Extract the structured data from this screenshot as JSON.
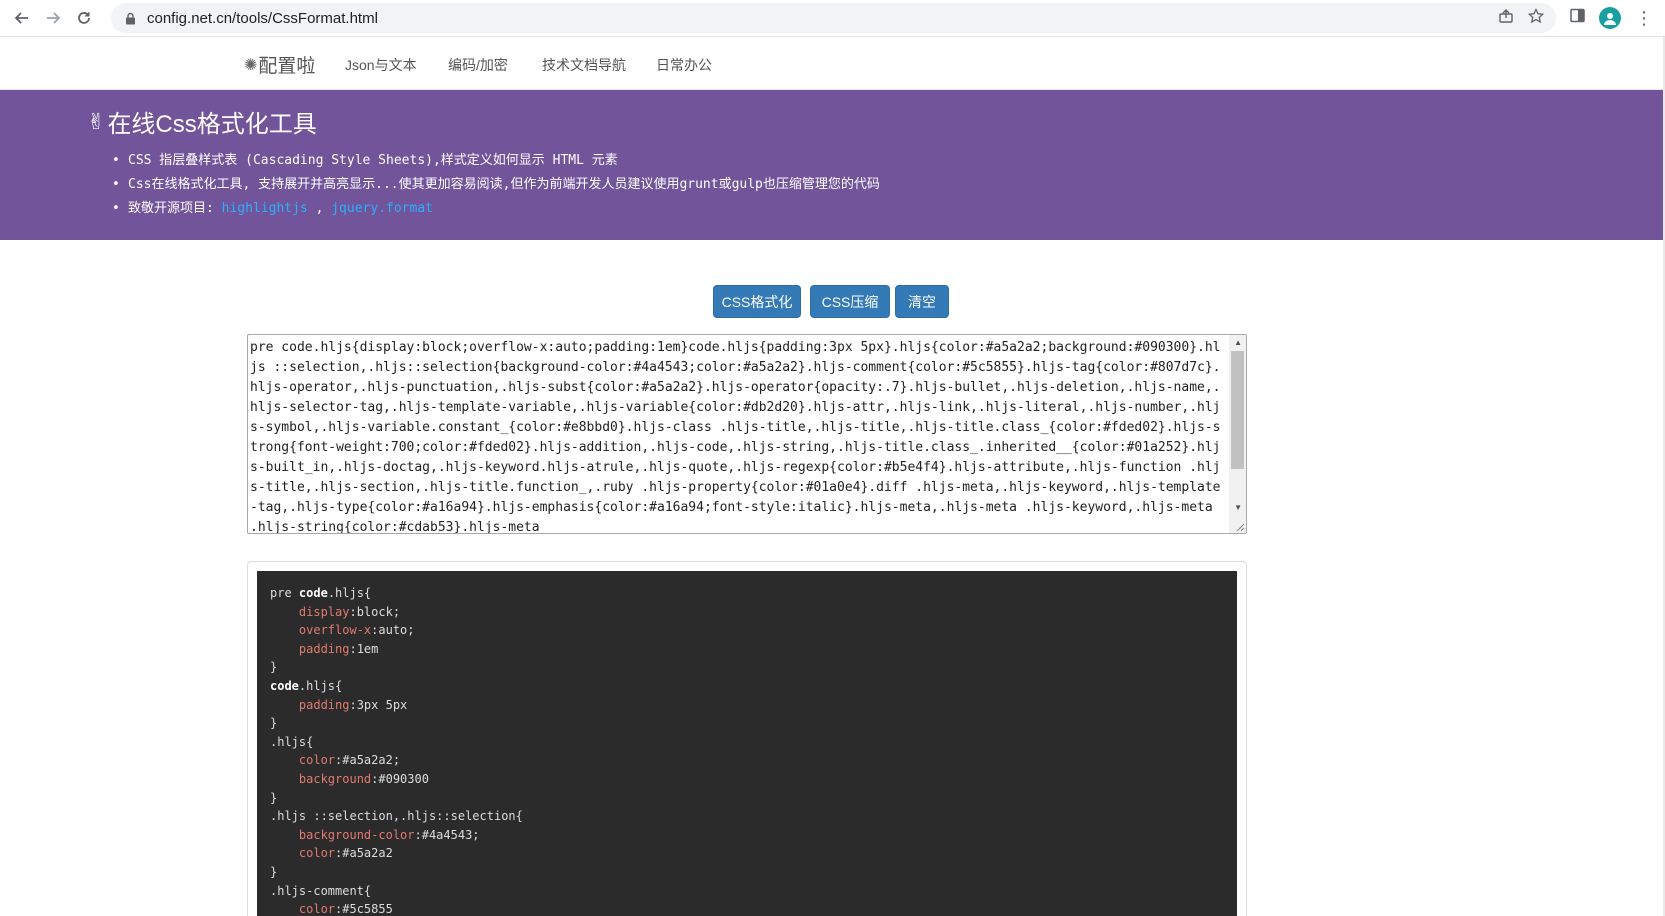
{
  "browser": {
    "url": "config.net.cn/tools/CssFormat.html"
  },
  "nav": {
    "brand": "配置啦",
    "links": [
      "Json与文本",
      "编码/加密",
      "技术文档导航",
      "日常办公"
    ]
  },
  "banner": {
    "title": "在线Css格式化工具",
    "bullet1": "CSS 指层叠样式表 (Cascading Style Sheets),样式定义如何显示 HTML 元素",
    "bullet2": "Css在线格式化工具, 支持展开并高亮显示...使其更加容易阅读,但作为前端开发人员建议使用grunt或gulp也压缩管理您的代码",
    "bullet3_prefix": "致敬开源项目: ",
    "link1": "highlightjs",
    "separator": " , ",
    "link2": "jquery.format"
  },
  "buttons": {
    "format": "CSS格式化",
    "compress": "CSS压缩",
    "clear": "清空"
  },
  "input": {
    "value": "pre code.hljs{display:block;overflow-x:auto;padding:1em}code.hljs{padding:3px 5px}.hljs{color:#a5a2a2;background:#090300}.hljs ::selection,.hljs::selection{background-color:#4a4543;color:#a5a2a2}.hljs-comment{color:#5c5855}.hljs-tag{color:#807d7c}.hljs-operator,.hljs-punctuation,.hljs-subst{color:#a5a2a2}.hljs-operator{opacity:.7}.hljs-bullet,.hljs-deletion,.hljs-name,.hljs-selector-tag,.hljs-template-variable,.hljs-variable{color:#db2d20}.hljs-attr,.hljs-link,.hljs-literal,.hljs-number,.hljs-symbol,.hljs-variable.constant_{color:#e8bbd0}.hljs-class .hljs-title,.hljs-title,.hljs-title.class_{color:#fded02}.hljs-strong{font-weight:700;color:#fded02}.hljs-addition,.hljs-code,.hljs-string,.hljs-title.class_.inherited__{color:#01a252}.hljs-built_in,.hljs-doctag,.hljs-keyword.hljs-atrule,.hljs-quote,.hljs-regexp{color:#b5e4f4}.hljs-attribute,.hljs-function .hljs-title,.hljs-section,.hljs-title.function_,.ruby .hljs-property{color:#01a0e4}.diff .hljs-meta,.hljs-keyword,.hljs-template-tag,.hljs-type{color:#a16a94}.hljs-emphasis{color:#a16a94;font-style:italic}.hljs-meta,.hljs-meta .hljs-keyword,.hljs-meta .hljs-string{color:#cdab53}.hljs-meta"
  },
  "output": {
    "lines": [
      {
        "parts": [
          {
            "t": "pre ",
            "c": ""
          },
          {
            "t": "code",
            "c": "kw"
          },
          {
            "t": ".hljs{",
            "c": ""
          }
        ]
      },
      {
        "parts": [
          {
            "t": "    ",
            "c": ""
          },
          {
            "t": "display",
            "c": "prop"
          },
          {
            "t": ":block;",
            "c": ""
          }
        ]
      },
      {
        "parts": [
          {
            "t": "    ",
            "c": ""
          },
          {
            "t": "overflow-x",
            "c": "prop"
          },
          {
            "t": ":auto;",
            "c": ""
          }
        ]
      },
      {
        "parts": [
          {
            "t": "    ",
            "c": ""
          },
          {
            "t": "padding",
            "c": "prop"
          },
          {
            "t": ":1em",
            "c": ""
          }
        ]
      },
      {
        "parts": [
          {
            "t": "}",
            "c": ""
          }
        ]
      },
      {
        "parts": [
          {
            "t": "code",
            "c": "kw"
          },
          {
            "t": ".hljs{",
            "c": ""
          }
        ]
      },
      {
        "parts": [
          {
            "t": "    ",
            "c": ""
          },
          {
            "t": "padding",
            "c": "prop"
          },
          {
            "t": ":3px 5px",
            "c": ""
          }
        ]
      },
      {
        "parts": [
          {
            "t": "}",
            "c": ""
          }
        ]
      },
      {
        "parts": [
          {
            "t": ".hljs{",
            "c": ""
          }
        ]
      },
      {
        "parts": [
          {
            "t": "    ",
            "c": ""
          },
          {
            "t": "color",
            "c": "prop"
          },
          {
            "t": ":#a5a2a2;",
            "c": ""
          }
        ]
      },
      {
        "parts": [
          {
            "t": "    ",
            "c": ""
          },
          {
            "t": "background",
            "c": "prop"
          },
          {
            "t": ":#090300",
            "c": ""
          }
        ]
      },
      {
        "parts": [
          {
            "t": "}",
            "c": ""
          }
        ]
      },
      {
        "parts": [
          {
            "t": ".hljs ::selection,.hljs::selection{",
            "c": ""
          }
        ]
      },
      {
        "parts": [
          {
            "t": "    ",
            "c": ""
          },
          {
            "t": "background-color",
            "c": "prop"
          },
          {
            "t": ":#4a4543;",
            "c": ""
          }
        ]
      },
      {
        "parts": [
          {
            "t": "    ",
            "c": ""
          },
          {
            "t": "color",
            "c": "prop"
          },
          {
            "t": ":#a5a2a2",
            "c": ""
          }
        ]
      },
      {
        "parts": [
          {
            "t": "}",
            "c": ""
          }
        ]
      },
      {
        "parts": [
          {
            "t": ".hljs-comment{",
            "c": ""
          }
        ]
      },
      {
        "parts": [
          {
            "t": "    ",
            "c": ""
          },
          {
            "t": "color",
            "c": "prop"
          },
          {
            "t": ":#5c5855",
            "c": ""
          }
        ]
      }
    ]
  },
  "colors": {
    "banner_bg": "#72549a",
    "button_bg": "#337ab7",
    "code_bg": "#2b2b2b",
    "code_prop": "#e07a6f",
    "link": "#29b1ff"
  },
  "icons": [
    "back-arrow-icon",
    "forward-arrow-icon",
    "reload-icon",
    "lock-icon",
    "share-icon",
    "star-icon",
    "sidepanel-icon",
    "profile-avatar-icon",
    "kebab-menu-icon",
    "gear-icon",
    "hand-icon"
  ]
}
